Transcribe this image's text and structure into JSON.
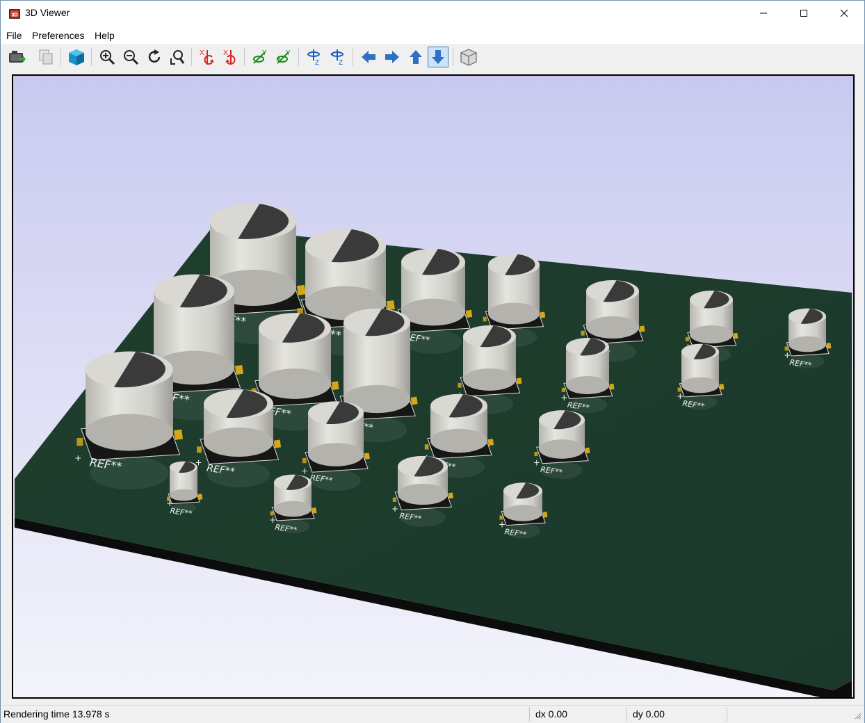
{
  "window": {
    "title": "3D Viewer"
  },
  "menu": {
    "items": [
      "File",
      "Preferences",
      "Help"
    ]
  },
  "toolbar": {
    "buttons": [
      "export-image-icon",
      "copy-icon",
      "render-raytracing-icon",
      "zoom-in-icon",
      "zoom-out-icon",
      "redraw-icon",
      "zoom-fit-icon",
      "rotate-x-cw-icon",
      "rotate-x-ccw-icon",
      "rotate-y-cw-icon",
      "rotate-y-ccw-icon",
      "rotate-z-cw-icon",
      "rotate-z-ccw-icon",
      "move-left-icon",
      "move-right-icon",
      "move-up-icon",
      "move-down-icon",
      "toggle-orthographic-icon"
    ],
    "active": "move-down-icon"
  },
  "scene": {
    "component_label": "REF**",
    "pin1_marker": "+",
    "colors": {
      "background_top": "#c9c9f0",
      "background_bottom": "#f4f4fb",
      "board": "#1d3c2c",
      "capacitor_body": "#d9d8d2",
      "capacitor_stripe": "#3a3a3a",
      "pad": "#d6a61a",
      "silkscreen": "#f2f2f2"
    }
  },
  "status": {
    "render_time": "Rendering time 13.978 s",
    "dx": "dx 0.00",
    "dy": "dy 0.00"
  }
}
